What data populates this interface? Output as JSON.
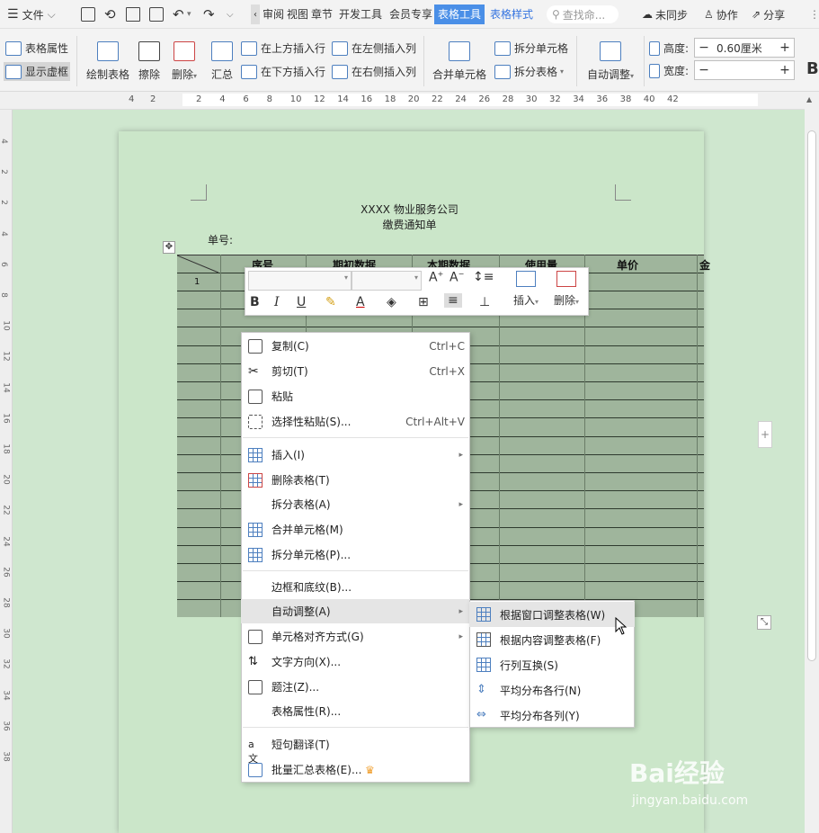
{
  "topbar": {
    "file_menu": "文件",
    "tabs": [
      "审阅",
      "视图",
      "章节",
      "开发工具",
      "会员专享",
      "表格工具",
      "表格样式"
    ],
    "search_placeholder": "查找命...",
    "sync_status": "未同步",
    "collaborate": "协作",
    "share": "分享"
  },
  "ribbon": {
    "table_props": "表格属性",
    "show_gridlines": "显示虚框",
    "draw_table": "绘制表格",
    "erase": "擦除",
    "delete": "删除",
    "summary": "汇总",
    "insert_above": "在上方插入行",
    "insert_below": "在下方插入行",
    "insert_left": "在左侧插入列",
    "insert_right": "在右侧插入列",
    "merge_cells": "合并单元格",
    "split_cells": "拆分单元格",
    "split_table": "拆分表格",
    "auto_fit": "自动调整",
    "height_label": "高度:",
    "height_value": "0.60厘米",
    "width_label": "宽度:",
    "width_value": "",
    "bold_partial": "B"
  },
  "ruler": {
    "left_ticks": [
      "4",
      "2"
    ],
    "ticks": [
      "2",
      "4",
      "6",
      "8",
      "10",
      "12",
      "14",
      "16",
      "18",
      "20",
      "22",
      "24",
      "26",
      "28",
      "30",
      "32",
      "34",
      "36",
      "38",
      "40",
      "42"
    ],
    "vticks": [
      "4",
      "2",
      "2",
      "4",
      "6",
      "8",
      "10",
      "12",
      "14",
      "16",
      "18",
      "20",
      "22",
      "24",
      "26",
      "28",
      "30",
      "32",
      "34",
      "36",
      "38"
    ]
  },
  "document": {
    "title": "XXXX 物业服务公司",
    "subtitle": "缴费通知单",
    "number_label": "单号:",
    "table_headers": [
      "序号",
      "期初数据",
      "本期数据",
      "使用量",
      "单价",
      "金"
    ],
    "first_row_index": "1"
  },
  "mini_toolbar": {
    "insert": "插入",
    "delete": "删除"
  },
  "context_menu": {
    "items": [
      {
        "label": "复制(C)",
        "shortcut": "Ctrl+C"
      },
      {
        "label": "剪切(T)",
        "shortcut": "Ctrl+X"
      },
      {
        "label": "粘贴",
        "shortcut": ""
      },
      {
        "label": "选择性粘贴(S)...",
        "shortcut": "Ctrl+Alt+V"
      },
      {
        "label": "插入(I)",
        "shortcut": ""
      },
      {
        "label": "删除表格(T)",
        "shortcut": ""
      },
      {
        "label": "拆分表格(A)",
        "shortcut": ""
      },
      {
        "label": "合并单元格(M)",
        "shortcut": ""
      },
      {
        "label": "拆分单元格(P)...",
        "shortcut": ""
      },
      {
        "label": "边框和底纹(B)...",
        "shortcut": ""
      },
      {
        "label": "自动调整(A)",
        "shortcut": ""
      },
      {
        "label": "单元格对齐方式(G)",
        "shortcut": ""
      },
      {
        "label": "文字方向(X)...",
        "shortcut": ""
      },
      {
        "label": "题注(Z)...",
        "shortcut": ""
      },
      {
        "label": "表格属性(R)...",
        "shortcut": ""
      },
      {
        "label": "短句翻译(T)",
        "shortcut": ""
      },
      {
        "label": "批量汇总表格(E)...",
        "shortcut": ""
      }
    ]
  },
  "submenu": {
    "items": [
      {
        "label": "根据窗口调整表格(W)"
      },
      {
        "label": "根据内容调整表格(F)"
      },
      {
        "label": "行列互换(S)"
      },
      {
        "label": "平均分布各行(N)"
      },
      {
        "label": "平均分布各列(Y)"
      }
    ]
  },
  "watermark": {
    "brand": "Bai经验",
    "url": "jingyan.baidu.com"
  },
  "colors": {
    "accent": "#4a8fe7",
    "page_bg": "#cbe6c9",
    "table_fill": "#9fb59c",
    "crown": "#f0a030"
  }
}
